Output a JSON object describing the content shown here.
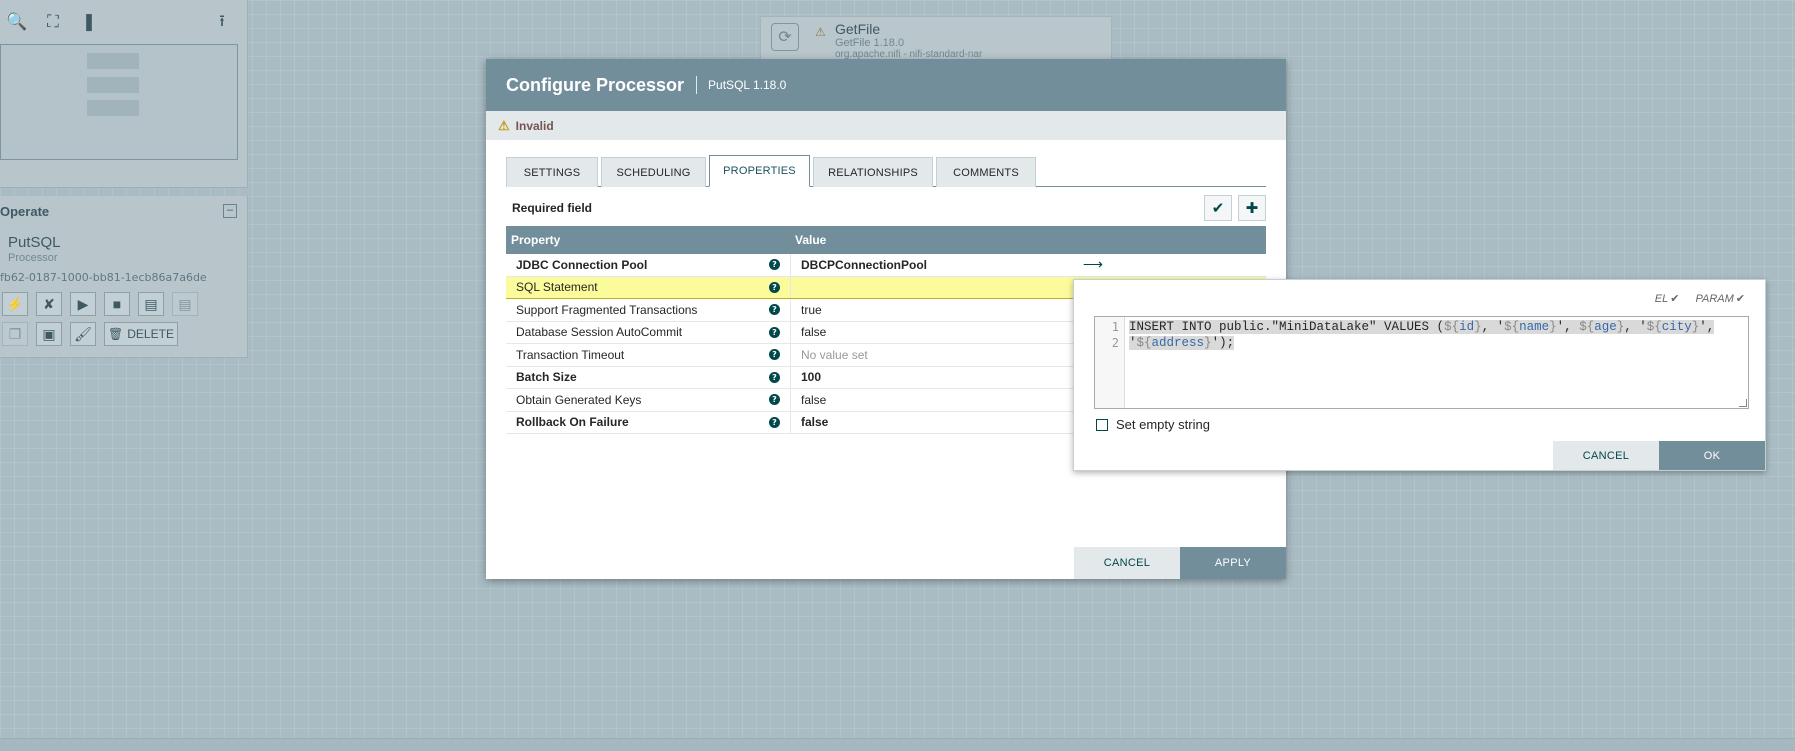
{
  "canvas": {
    "nav_tools": [
      "zoom-icon",
      "fit-icon",
      "actual-size-icon"
    ],
    "operate": {
      "title": "Operate",
      "component_name": "PutSQL",
      "component_type": "Processor",
      "component_id": "fb62-0187-1000-bb81-1ecb86a7a6de",
      "delete_label": "DELETE"
    },
    "bg_processor": {
      "name": "GetFile",
      "version": "GetFile 1.18.0",
      "bundle": "org.apache.nifi - nifi-standard-nar"
    }
  },
  "dialog": {
    "title": "Configure Processor",
    "subtitle": "PutSQL 1.18.0",
    "status": "Invalid",
    "tabs": [
      "SETTINGS",
      "SCHEDULING",
      "PROPERTIES",
      "RELATIONSHIPS",
      "COMMENTS"
    ],
    "active_tab": "PROPERTIES",
    "required_label": "Required field",
    "table": {
      "headers": [
        "Property",
        "Value"
      ],
      "rows": [
        {
          "name": "JDBC Connection Pool",
          "value": "DBCPConnectionPool",
          "bold": true
        },
        {
          "name": "SQL Statement",
          "value": "",
          "bold": false,
          "selected": true
        },
        {
          "name": "Support Fragmented Transactions",
          "value": "true",
          "bold": false
        },
        {
          "name": "Database Session AutoCommit",
          "value": "false",
          "bold": false
        },
        {
          "name": "Transaction Timeout",
          "value": "No value set",
          "bold": false,
          "empty": true
        },
        {
          "name": "Batch Size",
          "value": "100",
          "bold": true
        },
        {
          "name": "Obtain Generated Keys",
          "value": "false",
          "bold": false
        },
        {
          "name": "Rollback On Failure",
          "value": "false",
          "bold": true
        }
      ]
    },
    "cancel_label": "CANCEL",
    "apply_label": "APPLY"
  },
  "editor": {
    "el_label": "EL",
    "param_label": "PARAM",
    "line_numbers": [
      "1",
      "2"
    ],
    "set_empty_label": "Set empty string",
    "cancel_label": "CANCEL",
    "ok_label": "OK"
  }
}
